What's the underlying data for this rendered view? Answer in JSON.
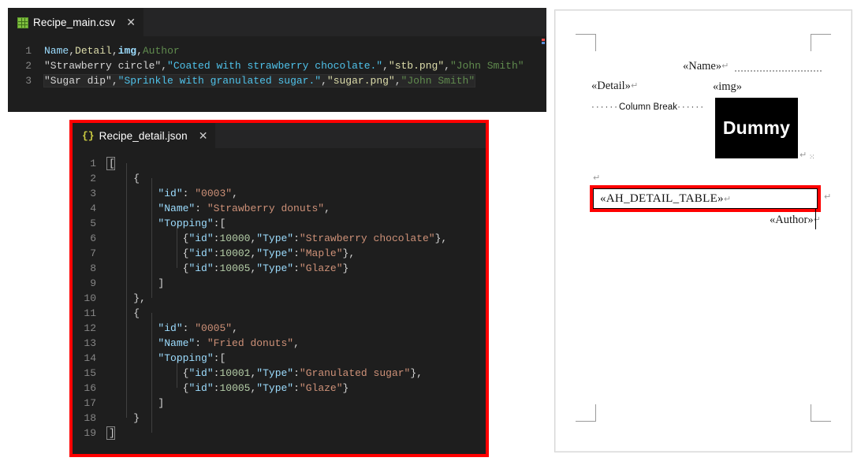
{
  "csv_editor": {
    "tab": {
      "filename": "Recipe_main.csv",
      "icon": "csv-table-icon",
      "close": "✕"
    },
    "lines": [
      {
        "num": "1",
        "highlighted": false
      },
      {
        "num": "2",
        "highlighted": false
      },
      {
        "num": "3",
        "highlighted": true
      }
    ],
    "line1": {
      "name": "Name",
      "c1": ",",
      "detail": "Detail",
      "c2": ",",
      "img": "img",
      "c3": ",",
      "author": "Author"
    },
    "line2": {
      "name": "\"Strawberry circle\"",
      "c1": ",",
      "detail": "\"Coated with strawberry chocolate.\"",
      "c2": ",",
      "img": "\"stb.png\"",
      "c3": ",",
      "author": "\"John Smith\""
    },
    "line3": {
      "name": "\"Sugar dip\"",
      "c1": ",",
      "detail": "\"Sprinkle with granulated sugar.\"",
      "c2": ",",
      "img": "\"sugar.png\"",
      "c3": ",",
      "author": "\"John Smith\""
    }
  },
  "json_editor": {
    "tab": {
      "filename": "Recipe_detail.json",
      "icon": "json-braces-icon",
      "close": "✕"
    },
    "highlight_color": "#ff0000",
    "line_numbers": [
      "1",
      "2",
      "3",
      "4",
      "5",
      "6",
      "7",
      "8",
      "9",
      "10",
      "11",
      "12",
      "13",
      "14",
      "15",
      "16",
      "17",
      "18",
      "19"
    ],
    "lines": [
      {
        "n": "1",
        "indent": 0,
        "tokens": [
          {
            "t": "punct",
            "v": "["
          }
        ]
      },
      {
        "n": "2",
        "indent": 1,
        "tokens": [
          {
            "t": "punct",
            "v": "{"
          }
        ]
      },
      {
        "n": "3",
        "indent": 2,
        "tokens": [
          {
            "t": "key",
            "v": "\"id\""
          },
          {
            "t": "punct",
            "v": ": "
          },
          {
            "t": "str",
            "v": "\"0003\""
          },
          {
            "t": "punct",
            "v": ","
          }
        ]
      },
      {
        "n": "4",
        "indent": 2,
        "tokens": [
          {
            "t": "key",
            "v": "\"Name\""
          },
          {
            "t": "punct",
            "v": ": "
          },
          {
            "t": "str",
            "v": "\"Strawberry donuts\""
          },
          {
            "t": "punct",
            "v": ","
          }
        ]
      },
      {
        "n": "5",
        "indent": 2,
        "tokens": [
          {
            "t": "key",
            "v": "\"Topping\""
          },
          {
            "t": "punct",
            "v": ":["
          }
        ]
      },
      {
        "n": "6",
        "indent": 3,
        "tokens": [
          {
            "t": "punct",
            "v": "{"
          },
          {
            "t": "key",
            "v": "\"id\""
          },
          {
            "t": "punct",
            "v": ":"
          },
          {
            "t": "num",
            "v": "10000"
          },
          {
            "t": "punct",
            "v": ","
          },
          {
            "t": "key",
            "v": "\"Type\""
          },
          {
            "t": "punct",
            "v": ":"
          },
          {
            "t": "str",
            "v": "\"Strawberry chocolate\""
          },
          {
            "t": "punct",
            "v": "},"
          }
        ]
      },
      {
        "n": "7",
        "indent": 3,
        "tokens": [
          {
            "t": "punct",
            "v": "{"
          },
          {
            "t": "key",
            "v": "\"id\""
          },
          {
            "t": "punct",
            "v": ":"
          },
          {
            "t": "num",
            "v": "10002"
          },
          {
            "t": "punct",
            "v": ","
          },
          {
            "t": "key",
            "v": "\"Type\""
          },
          {
            "t": "punct",
            "v": ":"
          },
          {
            "t": "str",
            "v": "\"Maple\""
          },
          {
            "t": "punct",
            "v": "},"
          }
        ]
      },
      {
        "n": "8",
        "indent": 3,
        "tokens": [
          {
            "t": "punct",
            "v": "{"
          },
          {
            "t": "key",
            "v": "\"id\""
          },
          {
            "t": "punct",
            "v": ":"
          },
          {
            "t": "num",
            "v": "10005"
          },
          {
            "t": "punct",
            "v": ","
          },
          {
            "t": "key",
            "v": "\"Type\""
          },
          {
            "t": "punct",
            "v": ":"
          },
          {
            "t": "str",
            "v": "\"Glaze\""
          },
          {
            "t": "punct",
            "v": "}"
          }
        ]
      },
      {
        "n": "9",
        "indent": 2,
        "tokens": [
          {
            "t": "punct",
            "v": "]"
          }
        ]
      },
      {
        "n": "10",
        "indent": 1,
        "tokens": [
          {
            "t": "punct",
            "v": "},"
          }
        ]
      },
      {
        "n": "11",
        "indent": 1,
        "tokens": [
          {
            "t": "punct",
            "v": "{"
          }
        ]
      },
      {
        "n": "12",
        "indent": 2,
        "tokens": [
          {
            "t": "key",
            "v": "\"id\""
          },
          {
            "t": "punct",
            "v": ": "
          },
          {
            "t": "str",
            "v": "\"0005\""
          },
          {
            "t": "punct",
            "v": ","
          }
        ]
      },
      {
        "n": "13",
        "indent": 2,
        "tokens": [
          {
            "t": "key",
            "v": "\"Name\""
          },
          {
            "t": "punct",
            "v": ": "
          },
          {
            "t": "str",
            "v": "\"Fried donuts\""
          },
          {
            "t": "punct",
            "v": ","
          }
        ]
      },
      {
        "n": "14",
        "indent": 2,
        "tokens": [
          {
            "t": "key",
            "v": "\"Topping\""
          },
          {
            "t": "punct",
            "v": ":["
          }
        ]
      },
      {
        "n": "15",
        "indent": 3,
        "tokens": [
          {
            "t": "punct",
            "v": "{"
          },
          {
            "t": "key",
            "v": "\"id\""
          },
          {
            "t": "punct",
            "v": ":"
          },
          {
            "t": "num",
            "v": "10001"
          },
          {
            "t": "punct",
            "v": ","
          },
          {
            "t": "key",
            "v": "\"Type\""
          },
          {
            "t": "punct",
            "v": ":"
          },
          {
            "t": "str",
            "v": "\"Granulated sugar\""
          },
          {
            "t": "punct",
            "v": "},"
          }
        ]
      },
      {
        "n": "16",
        "indent": 3,
        "tokens": [
          {
            "t": "punct",
            "v": "{"
          },
          {
            "t": "key",
            "v": "\"id\""
          },
          {
            "t": "punct",
            "v": ":"
          },
          {
            "t": "num",
            "v": "10005"
          },
          {
            "t": "punct",
            "v": ","
          },
          {
            "t": "key",
            "v": "\"Type\""
          },
          {
            "t": "punct",
            "v": ":"
          },
          {
            "t": "str",
            "v": "\"Glaze\""
          },
          {
            "t": "punct",
            "v": "}"
          }
        ]
      },
      {
        "n": "17",
        "indent": 2,
        "tokens": [
          {
            "t": "punct",
            "v": "]"
          }
        ]
      },
      {
        "n": "18",
        "indent": 1,
        "tokens": [
          {
            "t": "punct",
            "v": "}"
          }
        ]
      },
      {
        "n": "19",
        "indent": 0,
        "tokens": [
          {
            "t": "punct",
            "v": "]"
          }
        ]
      }
    ]
  },
  "document": {
    "fields": {
      "name": "«Name»",
      "detail": "«Detail»",
      "img": "«img»",
      "author": "«Author»",
      "detail_table": "«AH_DETAIL_TABLE»"
    },
    "column_break_label": "Column Break",
    "column_break_dots_left": "······",
    "column_break_dots_right": "······",
    "image_placeholder": "Dummy",
    "pilcrow": "↵",
    "tiny_dots": "⁙",
    "highlight_color": "#ff0000"
  }
}
